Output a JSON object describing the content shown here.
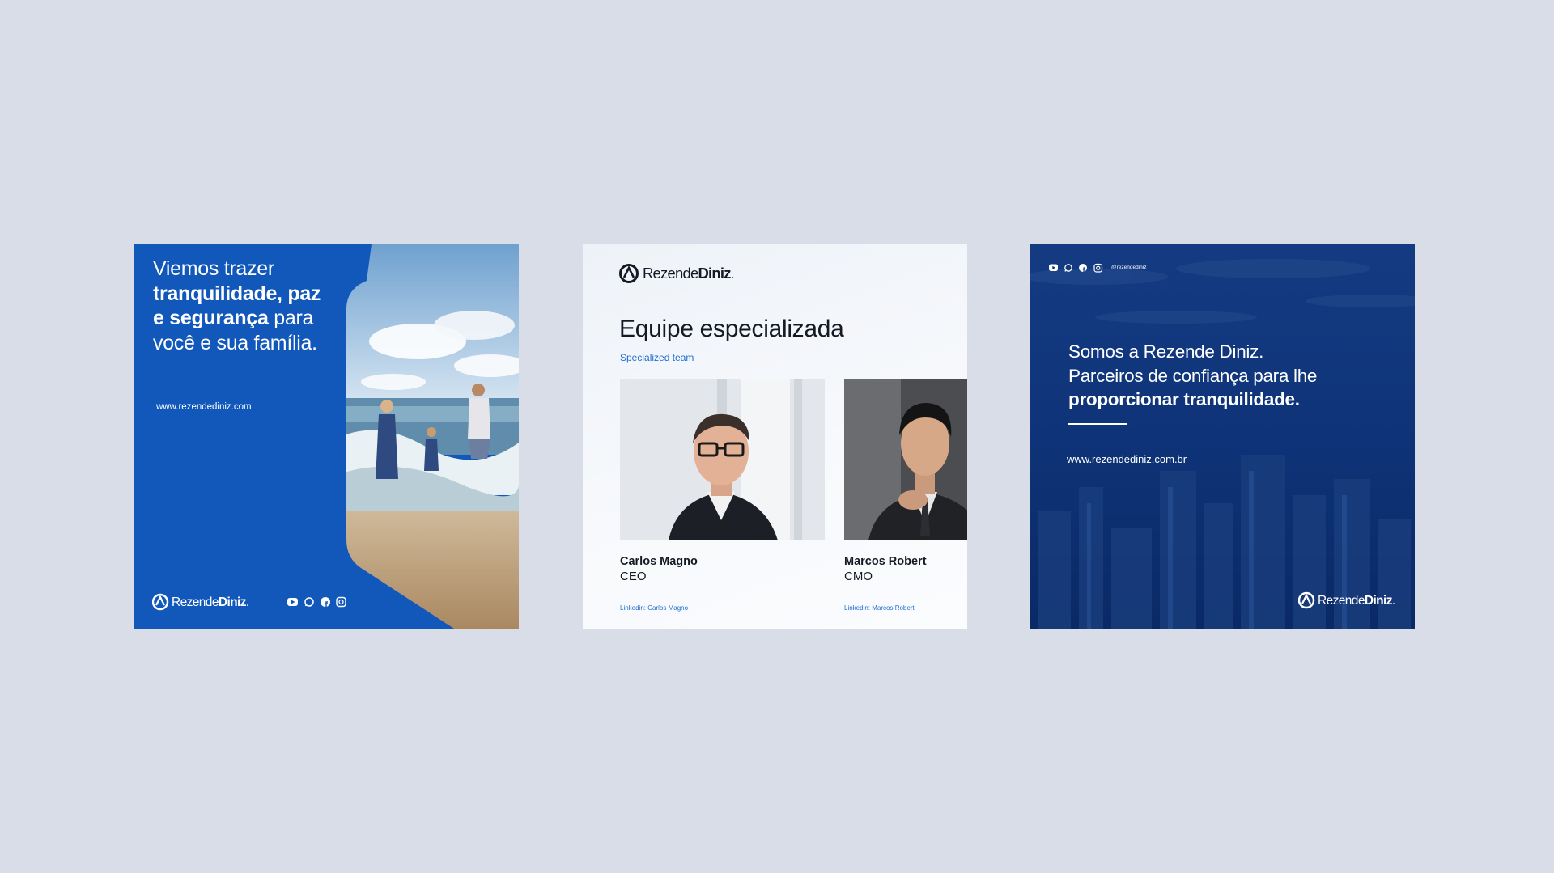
{
  "colors": {
    "background": "#d8dde7",
    "brand_blue": "#1158ba",
    "navy": "#0d3277",
    "link_blue": "#1f6fd0",
    "text_dark": "#141a24"
  },
  "brand": {
    "name_part1": "Rezende",
    "name_part2": "Diniz",
    "dot": "."
  },
  "card1": {
    "headline_line1": "Viemos trazer",
    "headline_bold1": "tranquilidade, paz",
    "headline_bold2": "e segurança",
    "headline_rest2": " para",
    "headline_line4": "você e sua família.",
    "url": "www.rezendediniz.com",
    "social_icons": [
      "youtube-icon",
      "whatsapp-icon",
      "facebook-icon",
      "instagram-icon"
    ]
  },
  "card2": {
    "title": "Equipe especializada",
    "subtitle": "Specialized team",
    "members": [
      {
        "name": "Carlos Magno",
        "role": "CEO",
        "link": "Linkedin: Carlos Magno"
      },
      {
        "name": "Marcos Robert",
        "role": "CMO",
        "link": "Linkedin: Marcos Robert"
      }
    ]
  },
  "card3": {
    "handle": "@rezendediniz",
    "headline_line1": "Somos a Rezende Diniz.",
    "headline_line2": "Parceiros de confiança para lhe",
    "headline_bold": "proporcionar tranquilidade.",
    "url": "www.rezendediniz.com.br",
    "social_icons": [
      "youtube-icon",
      "whatsapp-icon",
      "facebook-icon",
      "instagram-icon"
    ]
  }
}
